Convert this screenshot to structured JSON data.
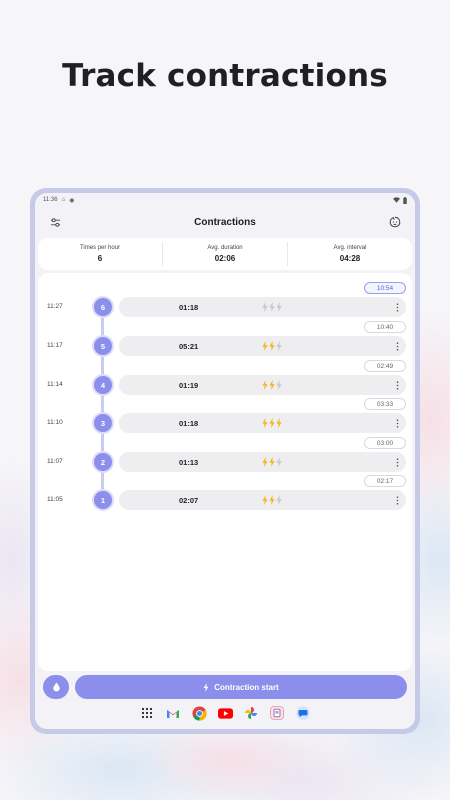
{
  "headline": "Track contractions",
  "status_bar": {
    "time": "11:36"
  },
  "app_bar": {
    "title": "Contractions"
  },
  "stats": [
    {
      "label": "Times per hour",
      "value": "6"
    },
    {
      "label": "Avg. duration",
      "value": "02:06"
    },
    {
      "label": "Avg. interval",
      "value": "04:28"
    }
  ],
  "intervals": [
    "10:54",
    "10:40",
    "02:49",
    "03:33",
    "03:00",
    "02:17"
  ],
  "contractions": [
    {
      "time": "11:27",
      "number": "6",
      "duration": "01:18",
      "intensity": 0
    },
    {
      "time": "11:17",
      "number": "5",
      "duration": "05:21",
      "intensity": 2
    },
    {
      "time": "11:14",
      "number": "4",
      "duration": "01:19",
      "intensity": 2
    },
    {
      "time": "11:10",
      "number": "3",
      "duration": "01:18",
      "intensity": 3
    },
    {
      "time": "11:07",
      "number": "2",
      "duration": "01:13",
      "intensity": 2
    },
    {
      "time": "11:05",
      "number": "1",
      "duration": "02:07",
      "intensity": 2
    }
  ],
  "buttons": {
    "start_label": "Contraction start"
  },
  "icons": {
    "filter": "sliders-icon",
    "baby": "baby-face-icon",
    "bolt": "lightning-icon",
    "more": "more-vert-icon",
    "tip": "drop-icon"
  },
  "taskbar_apps": [
    "app-drawer",
    "gmail",
    "chrome",
    "youtube",
    "photos",
    "gallery",
    "messages"
  ],
  "colors": {
    "accent": "#8b8eea",
    "bolt_active": "#f3b51b",
    "bolt_inactive": "#c6c6cc",
    "device_frame": "#c6cae6"
  }
}
